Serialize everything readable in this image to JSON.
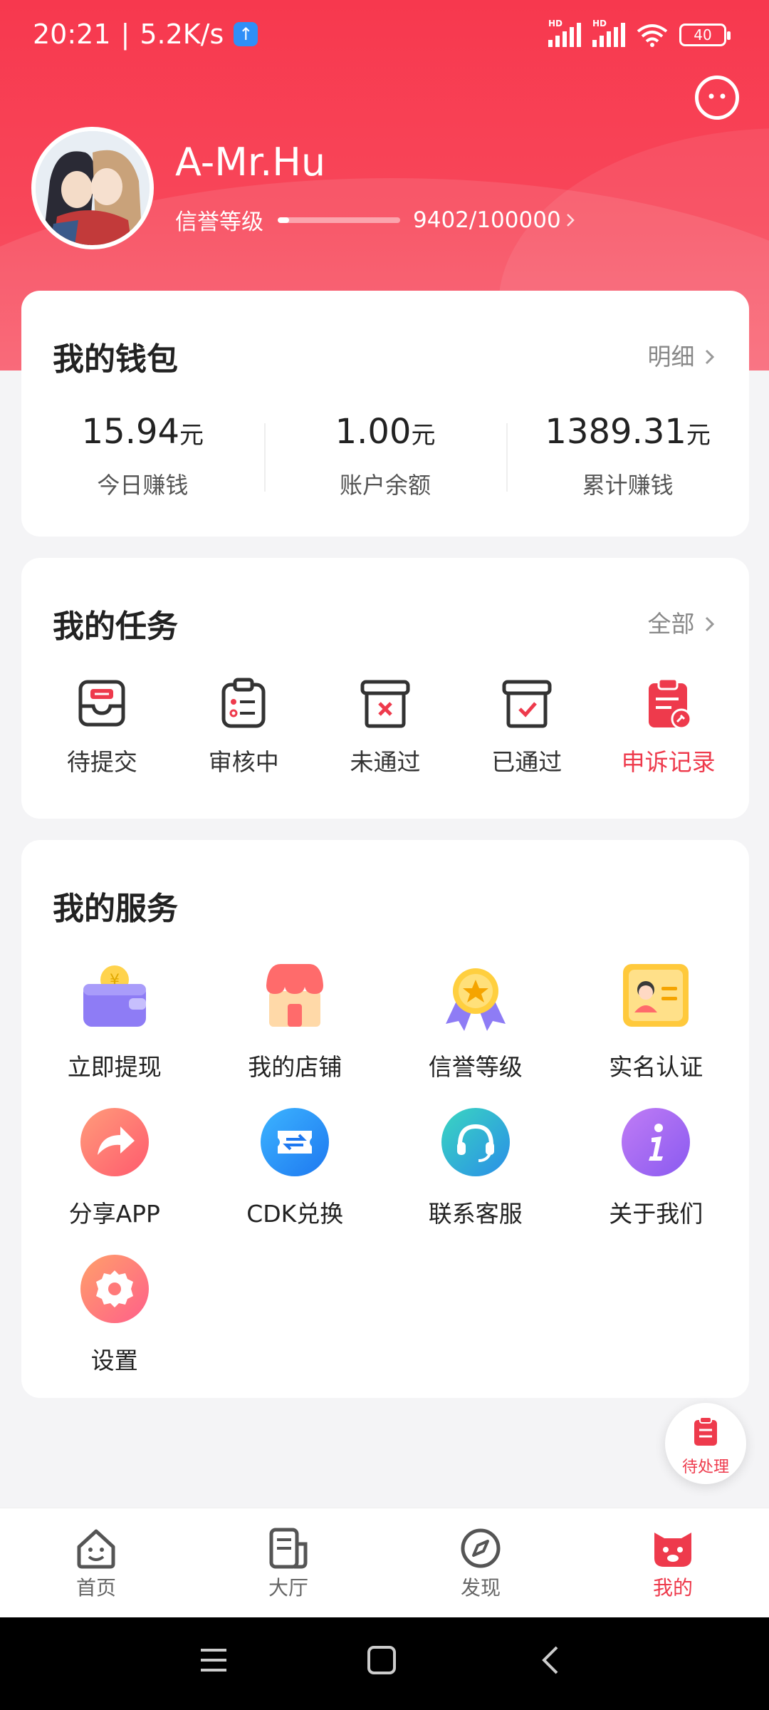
{
  "status_bar": {
    "time": "20:21",
    "speed": "5.2K/s",
    "battery": "40",
    "hd": "HD"
  },
  "profile": {
    "name": "A-Mr.Hu",
    "credit_label": "信誉等级",
    "credit_value": "9402/100000",
    "credit_progress": 0.094
  },
  "wallet": {
    "title": "我的钱包",
    "detail_link": "明细",
    "items": [
      {
        "amount": "15.94",
        "unit": "元",
        "label": "今日赚钱"
      },
      {
        "amount": "1.00",
        "unit": "元",
        "label": "账户余额"
      },
      {
        "amount": "1389.31",
        "unit": "元",
        "label": "累计赚钱"
      }
    ]
  },
  "tasks": {
    "title": "我的任务",
    "all_link": "全部",
    "items": [
      {
        "label": "待提交",
        "icon": "inbox-icon"
      },
      {
        "label": "审核中",
        "icon": "clipboard-list-icon"
      },
      {
        "label": "未通过",
        "icon": "archive-x-icon"
      },
      {
        "label": "已通过",
        "icon": "archive-check-icon"
      },
      {
        "label": "申诉记录",
        "icon": "appeal-record-icon"
      }
    ]
  },
  "services": {
    "title": "我的服务",
    "items": [
      {
        "label": "立即提现",
        "icon": "wallet-icon"
      },
      {
        "label": "我的店铺",
        "icon": "shop-icon"
      },
      {
        "label": "信誉等级",
        "icon": "medal-icon"
      },
      {
        "label": "实名认证",
        "icon": "id-card-icon"
      },
      {
        "label": "分享APP",
        "icon": "share-icon"
      },
      {
        "label": "CDK兑换",
        "icon": "ticket-exchange-icon"
      },
      {
        "label": "联系客服",
        "icon": "headset-icon"
      },
      {
        "label": "关于我们",
        "icon": "info-icon"
      },
      {
        "label": "设置",
        "icon": "settings-icon"
      }
    ]
  },
  "floating": {
    "label": "待处理"
  },
  "tabbar": {
    "items": [
      {
        "label": "首页",
        "icon": "home-face-icon"
      },
      {
        "label": "大厅",
        "icon": "document-icon"
      },
      {
        "label": "发现",
        "icon": "compass-icon"
      },
      {
        "label": "我的",
        "icon": "mine-icon"
      }
    ]
  },
  "colors": {
    "brand": "#ee3a4c",
    "header": "#f7384e"
  }
}
